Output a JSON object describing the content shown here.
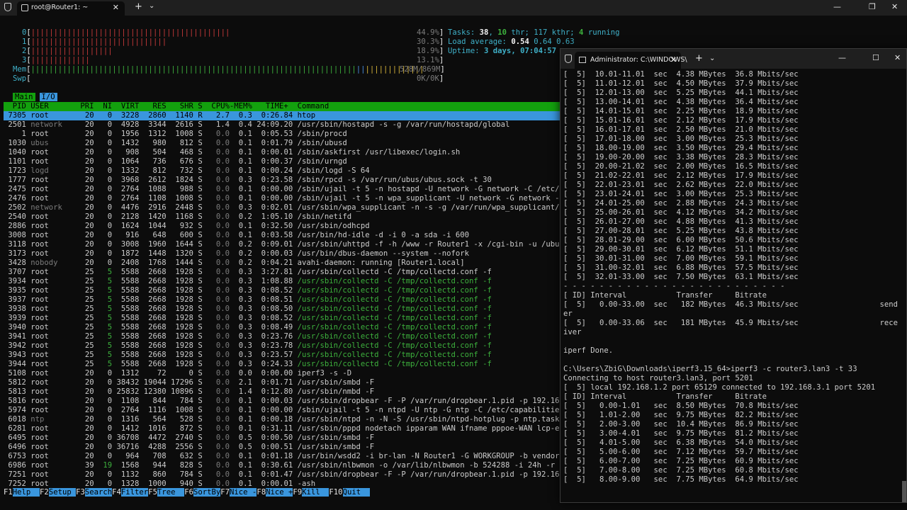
{
  "htop_window": {
    "tab_title": "root@Router1: ~",
    "cpu_lines": [
      {
        "label": "0",
        "bars": "||||||||||||||||||||||||||||||||||||||||||||",
        "pct": "44.9%"
      },
      {
        "label": "1",
        "bars": "||||||||||||||||||||||||||||||",
        "pct": "30.3%"
      },
      {
        "label": "2",
        "bars": "||||||||||||||||||",
        "pct": "18.9%"
      },
      {
        "label": "3",
        "bars": "|||||||||||||",
        "pct": "13.1%"
      }
    ],
    "mem": {
      "label": "Mem",
      "bars": "||||||||||||||||||||||||||||||||||||||||||||||||||||||||||||||||||||||||",
      "value": "528M/869M"
    },
    "swp": {
      "label": "Swp",
      "value": "0K/0K"
    },
    "tasks_label": "Tasks:",
    "tasks": "38",
    "thr": "10",
    "kthr": "117",
    "running": "4",
    "load_label": "Load average:",
    "load": [
      "0.54",
      "0.64",
      "0.63"
    ],
    "uptime_label": "Uptime:",
    "uptime": "3 days, 07:04:57",
    "tabs": [
      "Main",
      "I/O"
    ],
    "header": "  PID USER       PRI  NI  VIRT   RES   SHR S  CPU%-MEM%   TIME+  Command",
    "processes": [
      {
        "pid": "7305",
        "user": "root",
        "pri": "20",
        "ni": "0",
        "virt": "3228",
        "res": "2860",
        "shr": "1140",
        "s": "R",
        "cpu": "2.7",
        "mem": "0.3",
        "time": "0:26.84",
        "cmd": "htop"
      },
      {
        "pid": "2501",
        "user": "network",
        "pri": "20",
        "ni": "0",
        "virt": "4928",
        "res": "3344",
        "shr": "2616",
        "s": "S",
        "cpu": "1.4",
        "mem": "0.4",
        "time": "24:09.20",
        "cmd": "/usr/sbin/hostapd -s -g /var/run/hostapd/global"
      },
      {
        "pid": "1",
        "user": "root",
        "pri": "20",
        "ni": "0",
        "virt": "1956",
        "res": "1312",
        "shr": "1008",
        "s": "S",
        "cpu": "0.0",
        "mem": "0.1",
        "time": "0:05.53",
        "cmd": "/sbin/procd"
      },
      {
        "pid": "1030",
        "user": "ubus",
        "pri": "20",
        "ni": "0",
        "virt": "1432",
        "res": "980",
        "shr": "812",
        "s": "S",
        "cpu": "0.0",
        "mem": "0.1",
        "time": "0:01.79",
        "cmd": "/sbin/ubusd"
      },
      {
        "pid": "1040",
        "user": "root",
        "pri": "20",
        "ni": "0",
        "virt": "908",
        "res": "504",
        "shr": "468",
        "s": "S",
        "cpu": "0.0",
        "mem": "0.1",
        "time": "0:00.01",
        "cmd": "/sbin/askfirst /usr/libexec/login.sh"
      },
      {
        "pid": "1101",
        "user": "root",
        "pri": "20",
        "ni": "0",
        "virt": "1064",
        "res": "736",
        "shr": "676",
        "s": "S",
        "cpu": "0.0",
        "mem": "0.1",
        "time": "0:00.37",
        "cmd": "/sbin/urngd"
      },
      {
        "pid": "1723",
        "user": "logd",
        "pri": "20",
        "ni": "0",
        "virt": "1332",
        "res": "812",
        "shr": "732",
        "s": "S",
        "cpu": "0.0",
        "mem": "0.1",
        "time": "0:00.24",
        "cmd": "/sbin/logd -S 64"
      },
      {
        "pid": "1777",
        "user": "root",
        "pri": "20",
        "ni": "0",
        "virt": "3968",
        "res": "2612",
        "shr": "1824",
        "s": "S",
        "cpu": "0.0",
        "mem": "0.3",
        "time": "0:23.58",
        "cmd": "/sbin/rpcd -s /var/run/ubus/ubus.sock -t 30"
      },
      {
        "pid": "2475",
        "user": "root",
        "pri": "20",
        "ni": "0",
        "virt": "2764",
        "res": "1088",
        "shr": "988",
        "s": "S",
        "cpu": "0.0",
        "mem": "0.1",
        "time": "0:00.00",
        "cmd": "/sbin/ujail -t 5 -n hostapd -U network -G network -C /etc/c"
      },
      {
        "pid": "2476",
        "user": "root",
        "pri": "20",
        "ni": "0",
        "virt": "2764",
        "res": "1108",
        "shr": "1008",
        "s": "S",
        "cpu": "0.0",
        "mem": "0.1",
        "time": "0:00.00",
        "cmd": "/sbin/ujail -t 5 -n wpa_supplicant -U network -G network -C"
      },
      {
        "pid": "2502",
        "user": "network",
        "pri": "20",
        "ni": "0",
        "virt": "4476",
        "res": "2916",
        "shr": "2448",
        "s": "S",
        "cpu": "0.0",
        "mem": "0.3",
        "time": "0:02.01",
        "cmd": "/usr/sbin/wpa_supplicant -n -s -g /var/run/wpa_supplicant/g"
      },
      {
        "pid": "2540",
        "user": "root",
        "pri": "20",
        "ni": "0",
        "virt": "2128",
        "res": "1420",
        "shr": "1168",
        "s": "S",
        "cpu": "0.0",
        "mem": "0.2",
        "time": "1:05.10",
        "cmd": "/sbin/netifd"
      },
      {
        "pid": "2886",
        "user": "root",
        "pri": "20",
        "ni": "0",
        "virt": "1624",
        "res": "1044",
        "shr": "932",
        "s": "S",
        "cpu": "0.0",
        "mem": "0.1",
        "time": "0:32.50",
        "cmd": "/usr/sbin/odhcpd"
      },
      {
        "pid": "3008",
        "user": "root",
        "pri": "20",
        "ni": "0",
        "virt": "916",
        "res": "648",
        "shr": "600",
        "s": "S",
        "cpu": "0.0",
        "mem": "0.1",
        "time": "0:03.58",
        "cmd": "/usr/bin/hd-idle -d -i 0 -a sda -i 600"
      },
      {
        "pid": "3118",
        "user": "root",
        "pri": "20",
        "ni": "0",
        "virt": "3008",
        "res": "1960",
        "shr": "1644",
        "s": "S",
        "cpu": "0.0",
        "mem": "0.2",
        "time": "0:09.01",
        "cmd": "/usr/sbin/uhttpd -f -h /www -r Router1 -x /cgi-bin -u /ubus"
      },
      {
        "pid": "3173",
        "user": "root",
        "pri": "20",
        "ni": "0",
        "virt": "1872",
        "res": "1448",
        "shr": "1320",
        "s": "S",
        "cpu": "0.0",
        "mem": "0.2",
        "time": "0:00.03",
        "cmd": "/usr/bin/dbus-daemon --system --nofork"
      },
      {
        "pid": "3428",
        "user": "nobody",
        "pri": "20",
        "ni": "0",
        "virt": "2408",
        "res": "1768",
        "shr": "1444",
        "s": "S",
        "cpu": "0.0",
        "mem": "0.2",
        "time": "0:04.21",
        "cmd": "avahi-daemon: running [Router1.local]"
      },
      {
        "pid": "3707",
        "user": "root",
        "pri": "25",
        "ni": "5",
        "virt": "5588",
        "res": "2668",
        "shr": "1928",
        "s": "S",
        "cpu": "0.0",
        "mem": "0.3",
        "time": "3:27.81",
        "cmd": "/usr/sbin/collectd -C /tmp/collectd.conf -f"
      },
      {
        "pid": "3934",
        "user": "root",
        "pri": "25",
        "ni": "5",
        "virt": "5588",
        "res": "2668",
        "shr": "1928",
        "s": "S",
        "cpu": "0.0",
        "mem": "0.3",
        "time": "1:08.88",
        "cmd": "/usr/sbin/collectd -C /tmp/collectd.conf -f",
        "thread": true
      },
      {
        "pid": "3935",
        "user": "root",
        "pri": "25",
        "ni": "5",
        "virt": "5588",
        "res": "2668",
        "shr": "1928",
        "s": "S",
        "cpu": "0.0",
        "mem": "0.3",
        "time": "0:08.52",
        "cmd": "/usr/sbin/collectd -C /tmp/collectd.conf -f",
        "thread": true
      },
      {
        "pid": "3937",
        "user": "root",
        "pri": "25",
        "ni": "5",
        "virt": "5588",
        "res": "2668",
        "shr": "1928",
        "s": "S",
        "cpu": "0.0",
        "mem": "0.3",
        "time": "0:08.51",
        "cmd": "/usr/sbin/collectd -C /tmp/collectd.conf -f",
        "thread": true
      },
      {
        "pid": "3938",
        "user": "root",
        "pri": "25",
        "ni": "5",
        "virt": "5588",
        "res": "2668",
        "shr": "1928",
        "s": "S",
        "cpu": "0.0",
        "mem": "0.3",
        "time": "0:08.50",
        "cmd": "/usr/sbin/collectd -C /tmp/collectd.conf -f",
        "thread": true
      },
      {
        "pid": "3939",
        "user": "root",
        "pri": "25",
        "ni": "5",
        "virt": "5588",
        "res": "2668",
        "shr": "1928",
        "s": "S",
        "cpu": "0.0",
        "mem": "0.3",
        "time": "0:08.52",
        "cmd": "/usr/sbin/collectd -C /tmp/collectd.conf -f",
        "thread": true
      },
      {
        "pid": "3940",
        "user": "root",
        "pri": "25",
        "ni": "5",
        "virt": "5588",
        "res": "2668",
        "shr": "1928",
        "s": "S",
        "cpu": "0.0",
        "mem": "0.3",
        "time": "0:08.49",
        "cmd": "/usr/sbin/collectd -C /tmp/collectd.conf -f",
        "thread": true
      },
      {
        "pid": "3941",
        "user": "root",
        "pri": "25",
        "ni": "5",
        "virt": "5588",
        "res": "2668",
        "shr": "1928",
        "s": "S",
        "cpu": "0.0",
        "mem": "0.3",
        "time": "0:23.76",
        "cmd": "/usr/sbin/collectd -C /tmp/collectd.conf -f",
        "thread": true
      },
      {
        "pid": "3942",
        "user": "root",
        "pri": "25",
        "ni": "5",
        "virt": "5588",
        "res": "2668",
        "shr": "1928",
        "s": "S",
        "cpu": "0.0",
        "mem": "0.3",
        "time": "0:23.78",
        "cmd": "/usr/sbin/collectd -C /tmp/collectd.conf -f",
        "thread": true
      },
      {
        "pid": "3943",
        "user": "root",
        "pri": "25",
        "ni": "5",
        "virt": "5588",
        "res": "2668",
        "shr": "1928",
        "s": "S",
        "cpu": "0.0",
        "mem": "0.3",
        "time": "0:23.57",
        "cmd": "/usr/sbin/collectd -C /tmp/collectd.conf -f",
        "thread": true
      },
      {
        "pid": "3944",
        "user": "root",
        "pri": "25",
        "ni": "5",
        "virt": "5588",
        "res": "2668",
        "shr": "1928",
        "s": "S",
        "cpu": "0.0",
        "mem": "0.3",
        "time": "0:24.33",
        "cmd": "/usr/sbin/collectd -C /tmp/collectd.conf -f",
        "thread": true
      },
      {
        "pid": "5108",
        "user": "root",
        "pri": "20",
        "ni": "0",
        "virt": "1312",
        "res": "72",
        "shr": "0",
        "s": "S",
        "cpu": "0.0",
        "mem": "0.0",
        "time": "0:00.00",
        "cmd": "iperf3 -s -D"
      },
      {
        "pid": "5812",
        "user": "root",
        "pri": "20",
        "ni": "0",
        "virt": "38432",
        "res": "19044",
        "shr": "17296",
        "s": "S",
        "cpu": "0.0",
        "mem": "2.1",
        "time": "0:01.71",
        "cmd": "/usr/sbin/smbd -F"
      },
      {
        "pid": "5813",
        "user": "root",
        "pri": "20",
        "ni": "0",
        "virt": "25832",
        "res": "12380",
        "shr": "10896",
        "s": "S",
        "cpu": "0.0",
        "mem": "1.4",
        "time": "0:12.80",
        "cmd": "/usr/sbin/nmbd -F"
      },
      {
        "pid": "5816",
        "user": "root",
        "pri": "20",
        "ni": "0",
        "virt": "1108",
        "res": "844",
        "shr": "784",
        "s": "S",
        "cpu": "0.0",
        "mem": "0.1",
        "time": "0:00.03",
        "cmd": "/usr/sbin/dropbear -F -P /var/run/dropbear.1.pid -p 192.168"
      },
      {
        "pid": "5974",
        "user": "root",
        "pri": "20",
        "ni": "0",
        "virt": "2764",
        "res": "1116",
        "shr": "1008",
        "s": "S",
        "cpu": "0.0",
        "mem": "0.1",
        "time": "0:00.00",
        "cmd": "/sbin/ujail -t 5 -n ntpd -U ntp -G ntp -C /etc/capabilities"
      },
      {
        "pid": "6018",
        "user": "ntp",
        "pri": "20",
        "ni": "0",
        "virt": "1316",
        "res": "564",
        "shr": "528",
        "s": "S",
        "cpu": "0.0",
        "mem": "0.1",
        "time": "0:00.18",
        "cmd": "/usr/sbin/ntpd -n -N -S /usr/sbin/ntpd-hotplug -p ntp.task."
      },
      {
        "pid": "6281",
        "user": "root",
        "pri": "20",
        "ni": "0",
        "virt": "1412",
        "res": "1016",
        "shr": "872",
        "s": "S",
        "cpu": "0.0",
        "mem": "0.1",
        "time": "0:31.11",
        "cmd": "/usr/sbin/pppd nodetach ipparam WAN ifname pppoe-WAN lcp-ec"
      },
      {
        "pid": "6495",
        "user": "root",
        "pri": "20",
        "ni": "0",
        "virt": "36708",
        "res": "4472",
        "shr": "2740",
        "s": "S",
        "cpu": "0.0",
        "mem": "0.5",
        "time": "0:00.50",
        "cmd": "/usr/sbin/smbd -F"
      },
      {
        "pid": "6496",
        "user": "root",
        "pri": "20",
        "ni": "0",
        "virt": "36716",
        "res": "4288",
        "shr": "2556",
        "s": "S",
        "cpu": "0.0",
        "mem": "0.5",
        "time": "0:00.51",
        "cmd": "/usr/sbin/smbd -F"
      },
      {
        "pid": "6753",
        "user": "root",
        "pri": "20",
        "ni": "0",
        "virt": "964",
        "res": "708",
        "shr": "632",
        "s": "S",
        "cpu": "0.0",
        "mem": "0.1",
        "time": "0:01.18",
        "cmd": "/usr/bin/wsdd2 -i br-lan -N Router1 -G WORKGROUP -b vendor:"
      },
      {
        "pid": "6986",
        "user": "root",
        "pri": "39",
        "ni": "19",
        "virt": "1568",
        "res": "944",
        "shr": "828",
        "s": "S",
        "cpu": "0.0",
        "mem": "0.1",
        "time": "0:30.61",
        "cmd": "/usr/sbin/nlbwmon -o /var/lib/nlbwmon -b 524288 -i 24h -r 3"
      },
      {
        "pid": "7251",
        "user": "root",
        "pri": "20",
        "ni": "0",
        "virt": "1132",
        "res": "860",
        "shr": "784",
        "s": "S",
        "cpu": "0.0",
        "mem": "0.1",
        "time": "0:01.47",
        "cmd": "/usr/sbin/dropbear -F -P /var/run/dropbear.1.pid -p 192.168"
      },
      {
        "pid": "7252",
        "user": "root",
        "pri": "20",
        "ni": "0",
        "virt": "1328",
        "res": "1000",
        "shr": "940",
        "s": "S",
        "cpu": "0.0",
        "mem": "0.1",
        "time": "0:00.01",
        "cmd": "-ash"
      }
    ],
    "fkeys": [
      {
        "key": "F1",
        "label": "Help  "
      },
      {
        "key": "F2",
        "label": "Setup "
      },
      {
        "key": "F3",
        "label": "Search"
      },
      {
        "key": "F4",
        "label": "Filter"
      },
      {
        "key": "F5",
        "label": "Tree  "
      },
      {
        "key": "F6",
        "label": "SortBy"
      },
      {
        "key": "F7",
        "label": "Nice -"
      },
      {
        "key": "F8",
        "label": "Nice +"
      },
      {
        "key": "F9",
        "label": "Kill  "
      },
      {
        "key": "F10",
        "label": "Quit  "
      }
    ]
  },
  "cmd_window": {
    "tab_title": "Administrator: C:\\WINDOWS\\",
    "lines": [
      "[  5]  10.01-11.01  sec  4.38 MBytes  36.8 Mbits/sec",
      "[  5]  11.01-12.01  sec  4.50 MBytes  37.9 Mbits/sec",
      "[  5]  12.01-13.00  sec  5.25 MBytes  44.1 Mbits/sec",
      "[  5]  13.00-14.01  sec  4.38 MBytes  36.4 Mbits/sec",
      "[  5]  14.01-15.01  sec  2.25 MBytes  18.9 Mbits/sec",
      "[  5]  15.01-16.01  sec  2.12 MBytes  17.9 Mbits/sec",
      "[  5]  16.01-17.01  sec  2.50 MBytes  21.0 Mbits/sec",
      "[  5]  17.01-18.00  sec  3.00 MBytes  25.3 Mbits/sec",
      "[  5]  18.00-19.00  sec  3.50 MBytes  29.4 Mbits/sec",
      "[  5]  19.00-20.00  sec  3.38 MBytes  28.3 Mbits/sec",
      "[  5]  20.00-21.02  sec  2.00 MBytes  16.5 Mbits/sec",
      "[  5]  21.02-22.01  sec  2.12 MBytes  17.9 Mbits/sec",
      "[  5]  22.01-23.01  sec  2.62 MBytes  22.0 Mbits/sec",
      "[  5]  23.01-24.01  sec  3.00 MBytes  25.3 Mbits/sec",
      "[  5]  24.01-25.00  sec  2.88 MBytes  24.3 Mbits/sec",
      "[  5]  25.00-26.01  sec  4.12 MBytes  34.2 Mbits/sec",
      "[  5]  26.01-27.00  sec  4.88 MBytes  41.3 Mbits/sec",
      "[  5]  27.00-28.01  sec  5.25 MBytes  43.8 Mbits/sec",
      "[  5]  28.01-29.00  sec  6.00 MBytes  50.6 Mbits/sec",
      "[  5]  29.00-30.01  sec  6.12 MBytes  51.1 Mbits/sec",
      "[  5]  30.01-31.00  sec  7.00 MBytes  59.1 Mbits/sec",
      "[  5]  31.00-32.01  sec  6.88 MBytes  57.5 Mbits/sec",
      "[  5]  32.01-33.00  sec  7.50 MBytes  63.1 Mbits/sec",
      "- - - - - - - - - - - - - - - - - - - - - - - - -",
      "[ ID] Interval           Transfer     Bitrate",
      "[  5]   0.00-33.00  sec   182 MBytes  46.3 Mbits/sec                  send",
      "er",
      "[  5]   0.00-33.06  sec   181 MBytes  45.9 Mbits/sec                  rece",
      "iver",
      "",
      "iperf Done.",
      "",
      "C:\\Users\\ZbiG\\Downloads\\iperf3.15_64>iperf3 -c router3.lan3 -t 33",
      "Connecting to host router3.lan3, port 5201",
      "[  5] local 192.168.1.2 port 65129 connected to 192.168.3.1 port 5201",
      "[ ID] Interval           Transfer     Bitrate",
      "[  5]   0.00-1.01   sec  8.50 MBytes  70.8 Mbits/sec",
      "[  5]   1.01-2.00   sec  9.75 MBytes  82.2 Mbits/sec",
      "[  5]   2.00-3.00   sec  10.4 MBytes  86.9 Mbits/sec",
      "[  5]   3.00-4.01   sec  9.75 MBytes  81.2 Mbits/sec",
      "[  5]   4.01-5.00   sec  6.38 MBytes  54.0 Mbits/sec",
      "[  5]   5.00-6.00   sec  7.12 MBytes  59.7 Mbits/sec",
      "[  5]   6.00-7.00   sec  7.25 MBytes  60.9 Mbits/sec",
      "[  5]   7.00-8.00   sec  7.25 MBytes  60.8 Mbits/sec",
      "[  5]   8.00-9.00   sec  7.75 MBytes  64.9 Mbits/sec"
    ]
  }
}
